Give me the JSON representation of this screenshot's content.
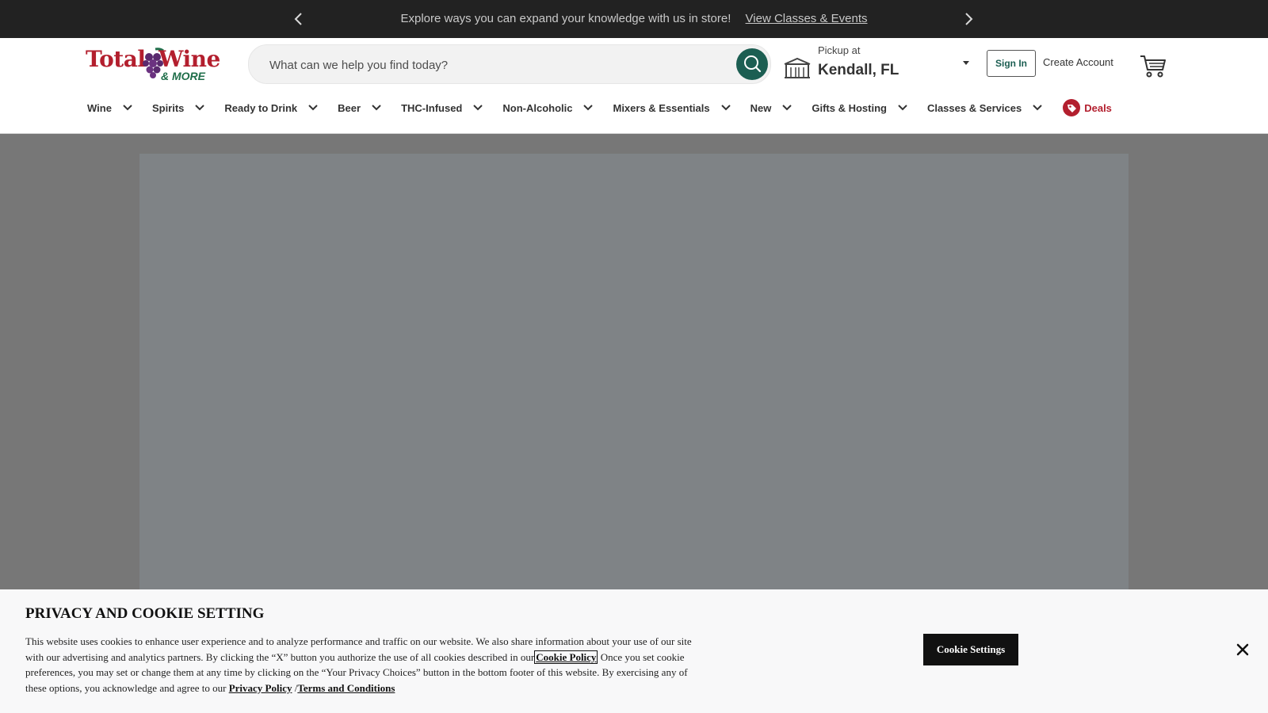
{
  "promo": {
    "message": "Explore ways you can expand your knowledge with us in store!",
    "link": "View Classes & Events",
    "prev_icon": "chevron-left-icon",
    "next_icon": "chevron-right-icon"
  },
  "header": {
    "logo": {
      "line1_a": "Total",
      "line1_b": "Wine",
      "line2": "& MORE"
    },
    "search": {
      "placeholder": "What can we help you find today?",
      "value": "",
      "icon": "search-icon"
    },
    "store": {
      "label": "Pickup at",
      "name": "Kendall, FL",
      "icon": "store-icon"
    },
    "sign_in": "Sign In",
    "create_account": "Create Account",
    "cart_icon": "cart-icon"
  },
  "nav": {
    "items": [
      {
        "label": "Wine"
      },
      {
        "label": "Spirits"
      },
      {
        "label": "Ready to Drink"
      },
      {
        "label": "Beer"
      },
      {
        "label": "THC-Infused"
      },
      {
        "label": "Non-Alcoholic"
      },
      {
        "label": "Mixers & Essentials"
      },
      {
        "label": "New"
      },
      {
        "label": "Gifts & Hosting"
      },
      {
        "label": "Classes & Services"
      }
    ],
    "deals": "Deals"
  },
  "cookie": {
    "title": "PRIVACY AND COOKIE SETTING",
    "text_1": "This website uses cookies to enhance user experience and to analyze performance and traffic on our website. We also share information about your use of our site with our advertising and analytics partners. By clicking the “X” button you authorize the use of all cookies described in our",
    "cookie_policy": "Cookie Policy",
    "text_2": " Once you set cookie preferences, you may set or change them at any time by clicking on the “Your Privacy Choices” button in the bottom footer of this website. By exercising any of these options, you acknowledge and agree to our ",
    "privacy_policy": "Privacy Policy",
    "separator": " /",
    "terms": "Terms and Conditions",
    "settings_button": "Cookie Settings",
    "close_icon": "close-icon"
  },
  "colors": {
    "promo_bg": "#222222",
    "brand_red": "#b31f2e",
    "brand_green": "#1c5e52",
    "overlay": "#777777"
  }
}
